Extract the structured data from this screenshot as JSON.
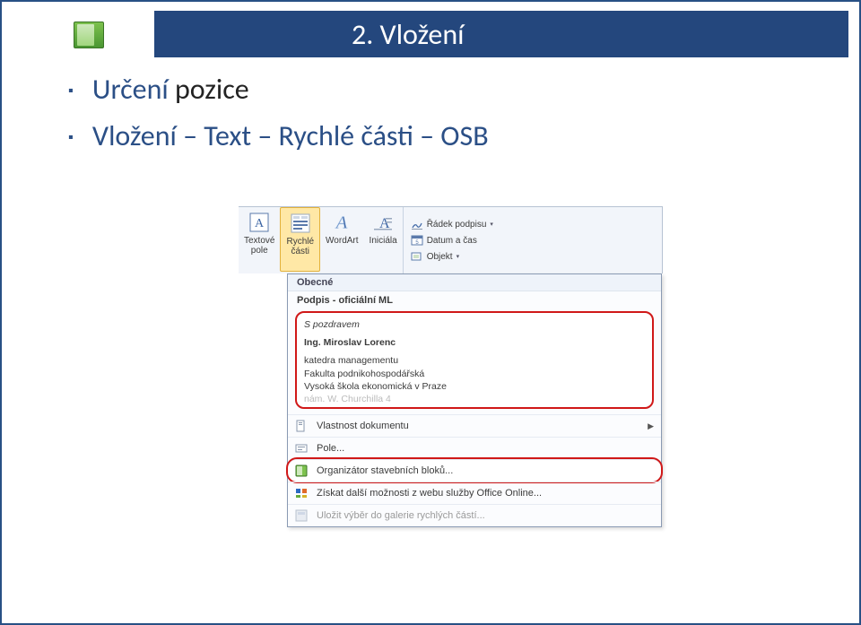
{
  "title": "2. Vložení",
  "bullets": {
    "item1_a": "Určení ",
    "item1_b": "pozice",
    "item2": "Vložení – Text – Rychlé části – OSB"
  },
  "ribbon": {
    "textove_pole": {
      "label": "Textové\npole"
    },
    "rychle_casti": {
      "label": "Rychlé\nčásti"
    },
    "wordart": {
      "label": "WordArt"
    },
    "iniciala": {
      "label": "Iniciála"
    },
    "mini": {
      "radek_podpisu": "Řádek podpisu",
      "datum_cas": "Datum a čas",
      "objekt": "Objekt"
    }
  },
  "dropdown": {
    "section_obecne": "Obecné",
    "heading": "Podpis - oficiální ML",
    "preview": {
      "greeting": "S pozdravem",
      "name": "Ing. Miroslav Lorenc",
      "line1": "katedra managementu",
      "line2": "Fakulta podnikohospodářská",
      "line3": "Vysoká škola ekonomická v Praze",
      "line4": "nám. W. Churchilla 4"
    },
    "rows": {
      "vlastnost": "Vlastnost dokumentu",
      "pole": "Pole...",
      "organizator": "Organizátor stavebních bloků...",
      "ziskat": "Získat další možnosti z webu služby Office Online...",
      "ulozit": "Uložit výběr do galerie rychlých částí..."
    }
  }
}
